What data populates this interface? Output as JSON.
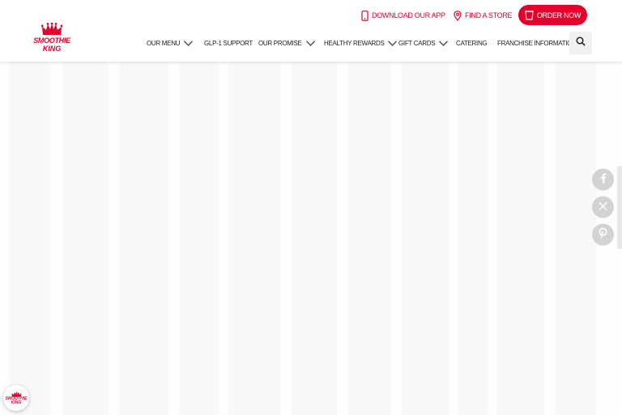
{
  "brand": {
    "logo_line1": "SMOOTHIE",
    "logo_line2": "KING",
    "accent_color": "#e4002b"
  },
  "utility": {
    "download_app": "DOWNLOAD OUR APP",
    "find_store": "FIND A STORE",
    "order_now": "ORDER NOW"
  },
  "nav": {
    "items": [
      {
        "label": "OUR MENU",
        "dropdown": true
      },
      {
        "label": "GLP-1 SUPPORT",
        "dropdown": false
      },
      {
        "label": "OUR PROMISE",
        "dropdown": true
      },
      {
        "label": "HEALTHY REWARDS",
        "dropdown": true
      },
      {
        "label": "GIFT CARDS",
        "dropdown": true
      },
      {
        "label": "CATERING",
        "dropdown": false
      },
      {
        "label": "FRANCHISE INFORMATION",
        "dropdown": false
      }
    ],
    "search_icon": "search-icon"
  },
  "social": {
    "items": [
      "facebook-icon",
      "x-icon",
      "pinterest-icon"
    ]
  },
  "badge": {
    "line1": "SMOOTHIE",
    "line2": "KING"
  }
}
